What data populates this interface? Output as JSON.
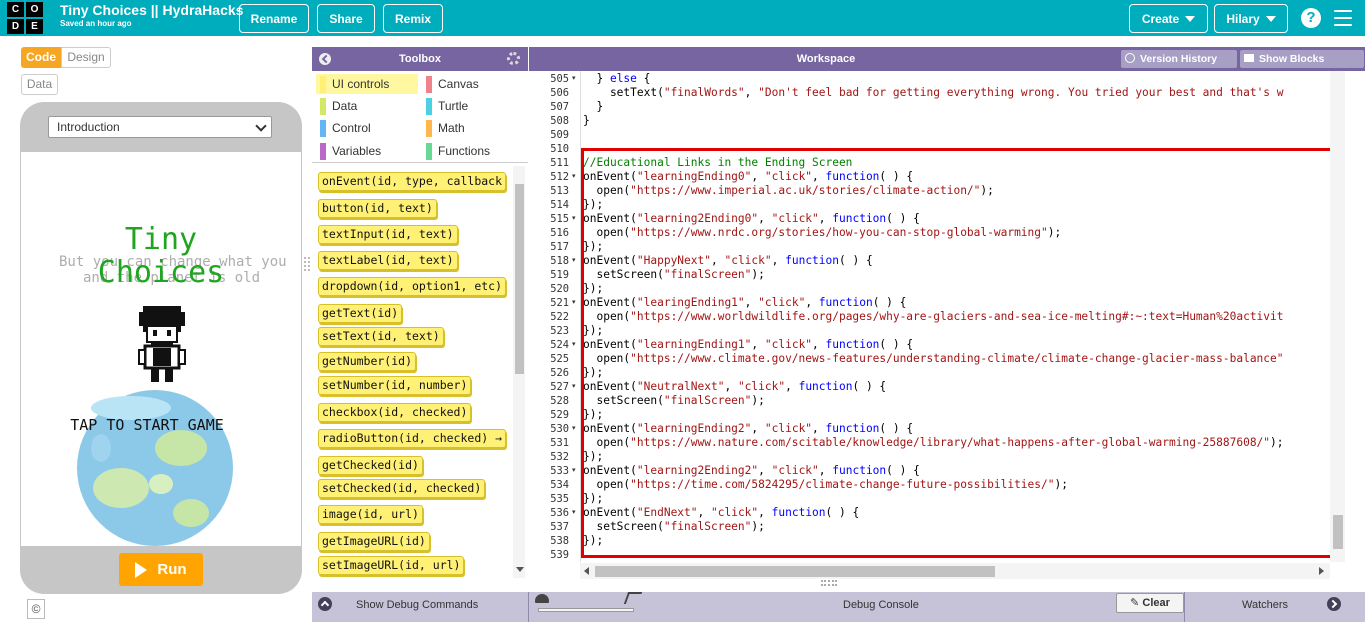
{
  "topbar": {
    "logo_letters": [
      "C",
      "O",
      "D",
      "E"
    ],
    "project_name": "Tiny Choices || HydraHacks",
    "saved_status": "Saved an hour ago",
    "rename": "Rename",
    "share": "Share",
    "remix": "Remix",
    "create": "Create",
    "user": "Hilary",
    "help": "?"
  },
  "left": {
    "code_tab": "Code",
    "design_tab": "Design",
    "data_btn": "Data",
    "screen_select": "Introduction",
    "app": {
      "title_line1": "Tiny",
      "title_line2": "Choices",
      "ghost_line1": "But you can change what you",
      "ghost_line2": "and the planet is old",
      "tap_label": "TAP TO START GAME"
    },
    "run": "Run",
    "copyright": "©"
  },
  "toolbox": {
    "title": "Toolbox",
    "categories": [
      {
        "label": "UI controls",
        "color": "#fff176",
        "selected": true
      },
      {
        "label": "Canvas",
        "color": "#f0828c"
      },
      {
        "label": "Data",
        "color": "#d3e965"
      },
      {
        "label": "Turtle",
        "color": "#4dd0e1"
      },
      {
        "label": "Control",
        "color": "#64b5f6"
      },
      {
        "label": "Math",
        "color": "#ffb74d"
      },
      {
        "label": "Variables",
        "color": "#ba68c8"
      },
      {
        "label": "Functions",
        "color": "#68d995"
      }
    ],
    "blocks": [
      "onEvent(id, type, callback",
      "button(id, text)",
      "textInput(id, text)",
      "textLabel(id, text)",
      "dropdown(id, option1, etc)",
      "getText(id)",
      "setText(id, text)",
      "getNumber(id)",
      "setNumber(id, number)",
      "checkbox(id, checked)",
      "radioButton(id, checked) →",
      "getChecked(id)",
      "setChecked(id, checked)",
      "image(id, url)",
      "getImageURL(id)",
      "setImageURL(id, url)"
    ]
  },
  "workspace": {
    "title": "Workspace",
    "version_history": "Version History",
    "show_blocks": "Show Blocks",
    "lines": [
      {
        "n": "505",
        "fold": true,
        "code": "  } else {"
      },
      {
        "n": "506",
        "code": "    setText(\"finalWords\", \"Don't feel bad for getting everything wrong. You tried your best and that's w"
      },
      {
        "n": "507",
        "code": "  }"
      },
      {
        "n": "508",
        "code": "}"
      },
      {
        "n": "509",
        "code": ""
      },
      {
        "n": "510",
        "code": ""
      },
      {
        "n": "511",
        "code": "//Educational Links in the Ending Screen"
      },
      {
        "n": "512",
        "fold": true,
        "code": "onEvent(\"learningEnding0\", \"click\", function( ) {"
      },
      {
        "n": "513",
        "code": "  open(\"https://www.imperial.ac.uk/stories/climate-action/\");"
      },
      {
        "n": "514",
        "code": "});"
      },
      {
        "n": "515",
        "fold": true,
        "code": "onEvent(\"learning2Ending0\", \"click\", function( ) {"
      },
      {
        "n": "516",
        "code": "  open(\"https://www.nrdc.org/stories/how-you-can-stop-global-warming\");"
      },
      {
        "n": "517",
        "code": "});"
      },
      {
        "n": "518",
        "fold": true,
        "code": "onEvent(\"HappyNext\", \"click\", function( ) {"
      },
      {
        "n": "519",
        "code": "  setScreen(\"finalScreen\");"
      },
      {
        "n": "520",
        "code": "});"
      },
      {
        "n": "521",
        "fold": true,
        "code": "onEvent(\"learingEnding1\", \"click\", function( ) {"
      },
      {
        "n": "522",
        "code": "  open(\"https://www.worldwildlife.org/pages/why-are-glaciers-and-sea-ice-melting#:~:text=Human%20activit"
      },
      {
        "n": "523",
        "code": "});"
      },
      {
        "n": "524",
        "fold": true,
        "code": "onEvent(\"learningEnding1\", \"click\", function( ) {"
      },
      {
        "n": "525",
        "code": "  open(\"https://www.climate.gov/news-features/understanding-climate/climate-change-glacier-mass-balance\""
      },
      {
        "n": "526",
        "code": "});"
      },
      {
        "n": "527",
        "fold": true,
        "code": "onEvent(\"NeutralNext\", \"click\", function( ) {"
      },
      {
        "n": "528",
        "code": "  setScreen(\"finalScreen\");"
      },
      {
        "n": "529",
        "code": "});"
      },
      {
        "n": "530",
        "fold": true,
        "code": "onEvent(\"learningEnding2\", \"click\", function( ) {"
      },
      {
        "n": "531",
        "code": "  open(\"https://www.nature.com/scitable/knowledge/library/what-happens-after-global-warming-25887608/\");"
      },
      {
        "n": "532",
        "code": "});"
      },
      {
        "n": "533",
        "fold": true,
        "code": "onEvent(\"learning2Ending2\", \"click\", function( ) {"
      },
      {
        "n": "534",
        "code": "  open(\"https://time.com/5824295/climate-change-future-possibilities/\");"
      },
      {
        "n": "535",
        "code": "});"
      },
      {
        "n": "536",
        "fold": true,
        "code": "onEvent(\"EndNext\", \"click\", function( ) {"
      },
      {
        "n": "537",
        "code": "  setScreen(\"finalScreen\");"
      },
      {
        "n": "538",
        "code": "});"
      },
      {
        "n": "539",
        "code": ""
      }
    ]
  },
  "debug": {
    "show_commands": "Show Debug Commands",
    "console": "Debug Console",
    "clear": "Clear",
    "watchers": "Watchers"
  },
  "colors": {
    "topbar": "#00adbc",
    "panel_header": "#7665a0",
    "keyword": "#0000ff",
    "string": "#a31515",
    "comment": "#008000",
    "highlight_box": "#e00000"
  }
}
